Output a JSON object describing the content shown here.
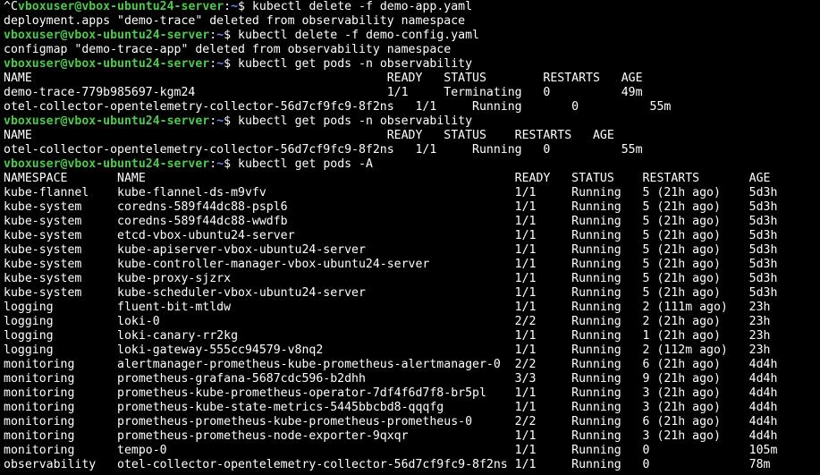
{
  "terminal": {
    "prompt": {
      "user_host": "vboxuser@vbox-ubuntu24-server",
      "cwd": "~"
    },
    "lines": [
      {
        "type": "prompt",
        "prefix": "^C",
        "cmd": "kubectl delete -f demo-app.yaml"
      },
      {
        "type": "output",
        "text": "deployment.apps \"demo-trace\" deleted from observability namespace"
      },
      {
        "type": "prompt",
        "cmd": "kubectl delete -f demo-config.yaml"
      },
      {
        "type": "output",
        "text": "configmap \"demo-trace-app\" deleted from observability namespace"
      },
      {
        "type": "prompt",
        "cmd": "kubectl get pods -n observability"
      },
      {
        "type": "output",
        "text": "NAME                                                  READY   STATUS        RESTARTS   AGE"
      },
      {
        "type": "output",
        "text": "demo-trace-779b985697-kgm24                           1/1     Terminating   0          49m"
      },
      {
        "type": "output",
        "text": "otel-collector-opentelemetry-collector-56d7cf9fc9-8f2ns   1/1     Running       0          55m"
      },
      {
        "type": "prompt",
        "cmd": "kubectl get pods -n observability"
      },
      {
        "type": "output",
        "text": "NAME                                                  READY   STATUS    RESTARTS   AGE"
      },
      {
        "type": "output",
        "text": "otel-collector-opentelemetry-collector-56d7cf9fc9-8f2ns   1/1     Running   0          55m"
      },
      {
        "type": "prompt",
        "cmd": "kubectl get pods -A"
      },
      {
        "type": "output",
        "text": "NAMESPACE       NAME                                                    READY   STATUS    RESTARTS       AGE"
      },
      {
        "type": "output",
        "text": "kube-flannel    kube-flannel-ds-m9vfv                                   1/1     Running   5 (21h ago)    5d3h"
      },
      {
        "type": "output",
        "text": "kube-system     coredns-589f44dc88-pspl6                                1/1     Running   5 (21h ago)    5d3h"
      },
      {
        "type": "output",
        "text": "kube-system     coredns-589f44dc88-wwdfb                                1/1     Running   5 (21h ago)    5d3h"
      },
      {
        "type": "output",
        "text": "kube-system     etcd-vbox-ubuntu24-server                               1/1     Running   5 (21h ago)    5d3h"
      },
      {
        "type": "output",
        "text": "kube-system     kube-apiserver-vbox-ubuntu24-server                     1/1     Running   5 (21h ago)    5d3h"
      },
      {
        "type": "output",
        "text": "kube-system     kube-controller-manager-vbox-ubuntu24-server            1/1     Running   5 (21h ago)    5d3h"
      },
      {
        "type": "output",
        "text": "kube-system     kube-proxy-sjzrx                                        1/1     Running   5 (21h ago)    5d3h"
      },
      {
        "type": "output",
        "text": "kube-system     kube-scheduler-vbox-ubuntu24-server                     1/1     Running   5 (21h ago)    5d3h"
      },
      {
        "type": "output",
        "text": "logging         fluent-bit-mtldw                                        1/1     Running   2 (111m ago)   23h"
      },
      {
        "type": "output",
        "text": "logging         loki-0                                                  2/2     Running   2 (21h ago)    23h"
      },
      {
        "type": "output",
        "text": "logging         loki-canary-rr2kg                                       1/1     Running   1 (21h ago)    23h"
      },
      {
        "type": "output",
        "text": "logging         loki-gateway-555cc94579-v8nq2                           1/1     Running   2 (112m ago)   23h"
      },
      {
        "type": "output",
        "text": "monitoring      alertmanager-prometheus-kube-prometheus-alertmanager-0  2/2     Running   6 (21h ago)    4d4h"
      },
      {
        "type": "output",
        "text": "monitoring      prometheus-grafana-5687cdc596-b2dhh                     3/3     Running   9 (21h ago)    4d4h"
      },
      {
        "type": "output",
        "text": "monitoring      prometheus-kube-prometheus-operator-7df4f6d7f8-br5pl    1/1     Running   3 (21h ago)    4d4h"
      },
      {
        "type": "output",
        "text": "monitoring      prometheus-kube-state-metrics-5445bbcbd8-qqqfg          1/1     Running   3 (21h ago)    4d4h"
      },
      {
        "type": "output",
        "text": "monitoring      prometheus-prometheus-kube-prometheus-prometheus-0      2/2     Running   6 (21h ago)    4d4h"
      },
      {
        "type": "output",
        "text": "monitoring      prometheus-prometheus-node-exporter-9qxqr               1/1     Running   3 (21h ago)    4d4h"
      },
      {
        "type": "output",
        "text": "monitoring      tempo-0                                                 1/1     Running   0              105m"
      },
      {
        "type": "output",
        "text": "observability   otel-collector-opentelemetry-collector-56d7cf9fc9-8f2ns 1/1     Running   0              78m"
      }
    ]
  },
  "colors": {
    "background": "#000000",
    "user_host": "#4ec94e",
    "cwd": "#5b8fff",
    "text": "#ffffff"
  }
}
